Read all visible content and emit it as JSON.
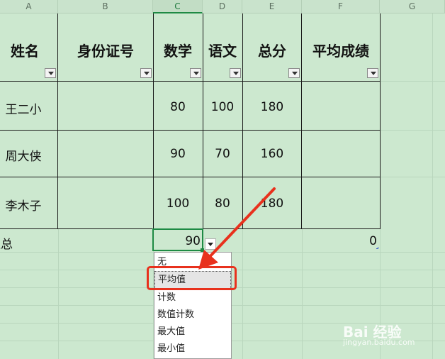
{
  "columns": [
    "A",
    "B",
    "C",
    "D",
    "E",
    "F",
    "G"
  ],
  "headers": {
    "name": "姓名",
    "id": "身份证号",
    "math": "数学",
    "chinese": "语文",
    "total": "总分",
    "avg": "平均成绩"
  },
  "rows": [
    {
      "name": "王二小",
      "math": "80",
      "chinese": "100",
      "total": "180"
    },
    {
      "name": "周大侠",
      "math": "90",
      "chinese": "70",
      "total": "160"
    },
    {
      "name": "李木子",
      "math": "100",
      "chinese": "80",
      "total": "180"
    }
  ],
  "summary": {
    "label": "汇总",
    "math_value": "90",
    "avg_value": "0"
  },
  "dropdown": {
    "items": [
      "无",
      "平均值",
      "计数",
      "数值计数",
      "最大值",
      "最小值"
    ],
    "selected": "平均值"
  },
  "watermark": {
    "brand": "Bai 经验",
    "url": "jingyan.baidu.com"
  },
  "colors": {
    "sheet_bg": "#cce8cf",
    "annotation": "#e8311d",
    "selection": "#1e8a44"
  }
}
